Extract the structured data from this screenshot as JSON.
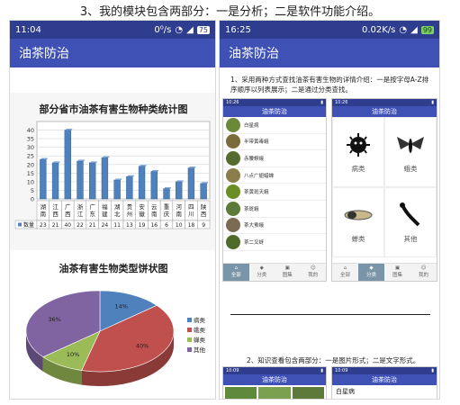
{
  "caption": "3、我的模块包含两部分：一是分析；二是软件功能介绍。",
  "left_phone": {
    "status_time": "11:04",
    "status_icons": "0⁰/s",
    "battery": "75",
    "app_title": "油茶防治",
    "bar_chart_title": "部分省市油茶有害生物种类统计图",
    "pie_chart_title": "油茶有害生物类型饼状图"
  },
  "right_phone": {
    "status_time": "16:25",
    "status_icons": "0.02K/s",
    "battery": "99",
    "app_title": "油茶防治",
    "note1": "1、采用两种方式查找油茶有害生物的详情介绍：一是按字母A-Z排序顺序以列表展示；二是通过分类查找。",
    "note2": "2、知识查看包含两部分：一是图片形式；二是文字形式。",
    "mini_list": {
      "status_time": "10:26",
      "title": "油茶防治",
      "items": [
        "白星病",
        "半带黄毒蛾",
        "赤腰螟蛾",
        "八点广翅蜡蝉",
        "茶黄斑天蛾",
        "茶斑蛾",
        "茶大蚕蛾",
        "茶二叉蚜"
      ],
      "nav": [
        "全部",
        "分类",
        "图集",
        "我的"
      ]
    },
    "mini_grid": {
      "status_time": "10:26",
      "title": "油茶防治",
      "cells": [
        "病类",
        "蛾类",
        "蝉类",
        "其他"
      ],
      "nav": [
        "全部",
        "分类",
        "图集",
        "我的"
      ]
    },
    "mini_bottom": {
      "status_time": "10:09",
      "title": "油茶防治",
      "item": "白星病"
    }
  },
  "chart_data": [
    {
      "type": "bar",
      "title": "部分省市油茶有害生物种类统计图",
      "categories": [
        "湖南",
        "江西",
        "广西",
        "浙江",
        "广东",
        "福建",
        "湖北",
        "贵州",
        "安徽",
        "云南",
        "重庆",
        "河南",
        "四川",
        "陕西"
      ],
      "series": [
        {
          "name": "数量",
          "values": [
            23,
            21,
            40,
            22,
            21,
            24,
            11,
            13,
            19,
            16,
            6,
            10,
            18,
            9
          ]
        }
      ],
      "ylim": [
        0,
        45
      ],
      "yticks": [
        0,
        5,
        10,
        15,
        20,
        25,
        30,
        35,
        40
      ],
      "grid": true,
      "legend": "bottom-left"
    },
    {
      "type": "pie",
      "title": "油茶有害生物类型饼状图",
      "labels": [
        "病类",
        "蛾类",
        "蝉类",
        "其他"
      ],
      "values": [
        14,
        40,
        10,
        36
      ],
      "value_labels": [
        "14%",
        "40%",
        "10%",
        "36%"
      ],
      "colors": [
        "#4f81bd",
        "#c0504d",
        "#9bbb59",
        "#8064a2"
      ],
      "legend": "right"
    }
  ]
}
